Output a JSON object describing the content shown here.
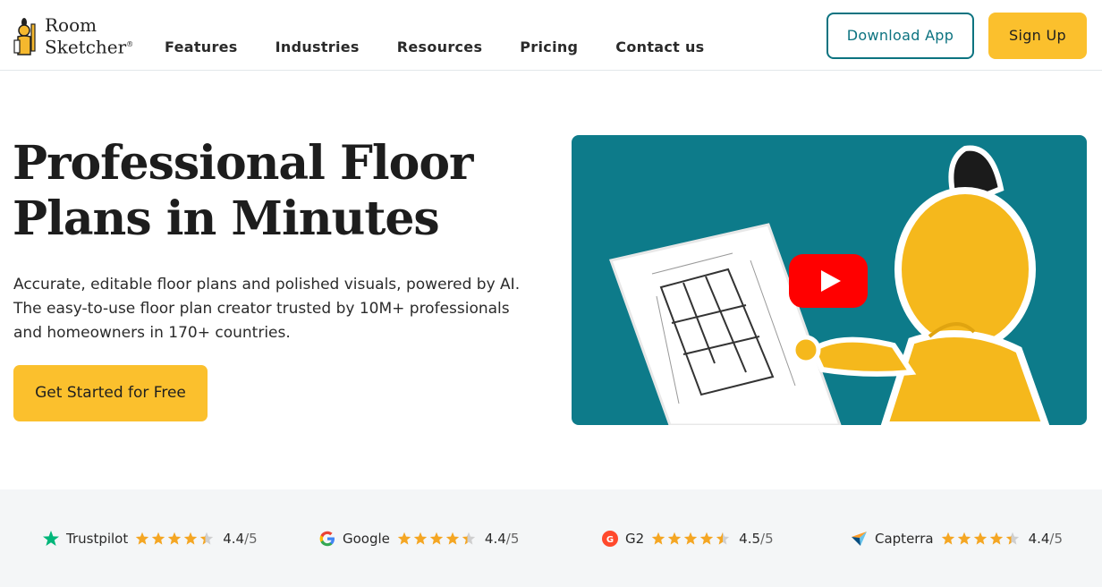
{
  "brand": {
    "line1": "Room",
    "line2": "Sketcher",
    "reg": "®"
  },
  "nav": [
    {
      "label": "Features"
    },
    {
      "label": "Industries"
    },
    {
      "label": "Resources"
    },
    {
      "label": "Pricing"
    },
    {
      "label": "Contact us"
    }
  ],
  "header_buttons": {
    "download": "Download App",
    "signup": "Sign Up"
  },
  "hero": {
    "title_line1": "Professional Floor",
    "title_line2": "Plans in Minutes",
    "sub_line1": "Accurate, editable floor plans and polished visuals, powered by AI.",
    "sub_line2": "The easy-to-use floor plan creator trusted by 10M+ professionals",
    "sub_line3": "and homeowners in 170+ countries.",
    "cta": "Get Started for Free"
  },
  "video": {
    "icon": "youtube-play-icon",
    "bg_color": "#0d7b8a"
  },
  "ratings": [
    {
      "name": "Trustpilot",
      "icon": "trustpilot-star-icon",
      "score": "4.4",
      "outof": "/5",
      "stars": 4.4
    },
    {
      "name": "Google",
      "icon": "google-g-icon",
      "score": "4.4",
      "outof": "/5",
      "stars": 4.4
    },
    {
      "name": "G2",
      "icon": "g2-icon",
      "score": "4.5",
      "outof": "/5",
      "stars": 4.5
    },
    {
      "name": "Capterra",
      "icon": "capterra-arrow-icon",
      "score": "4.4",
      "outof": "/5",
      "stars": 4.4
    }
  ],
  "colors": {
    "accent_yellow": "#fbc02d",
    "teal": "#0c7380",
    "star": "#f4a623"
  }
}
